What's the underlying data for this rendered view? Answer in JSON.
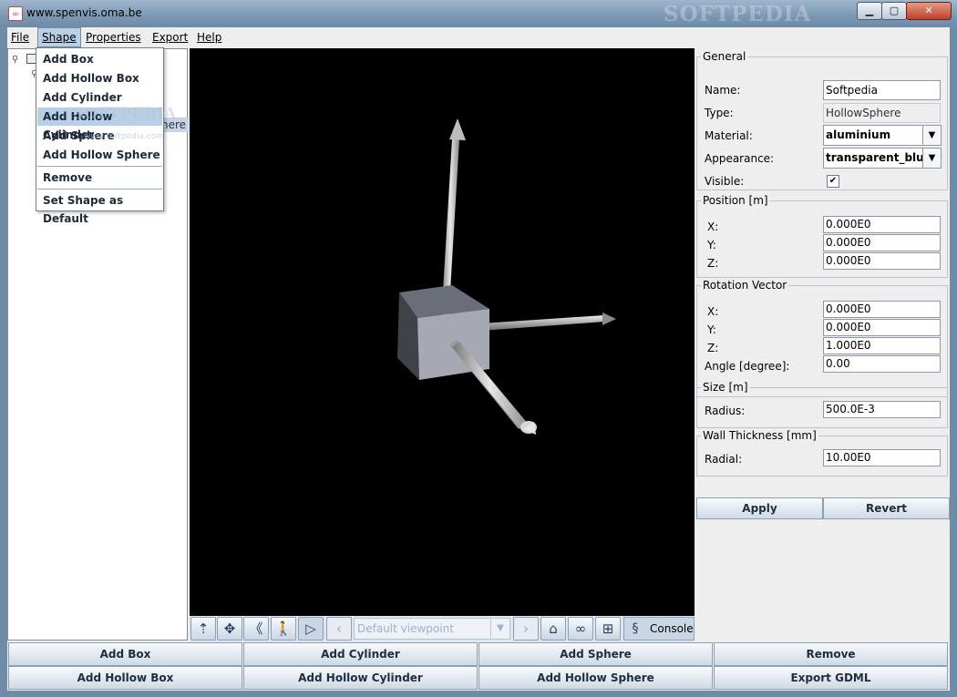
{
  "window": {
    "title": "www.spenvis.oma.be",
    "watermark": "SOFTPEDIA",
    "minimize": "▁",
    "maximize": "▢",
    "close": "✕"
  },
  "menubar": {
    "items": [
      "File",
      "Shape",
      "Properties",
      "Export",
      "Help"
    ],
    "open_menu": "Shape"
  },
  "shape_menu": {
    "items": [
      "Add Box",
      "Add Hollow Box",
      "Add Cylinder",
      "Add Hollow Cylinder",
      "Add Sphere",
      "Add Hollow Sphere"
    ],
    "highlighted": "Add Hollow Cylinder",
    "remove": "Remove",
    "set_default": "Set Shape as Default",
    "overlay_watermark": "SOFTPEDIA",
    "overlay_url": "www.softpedia.com"
  },
  "tree": {
    "selected_suffix": "here"
  },
  "navbar": {
    "viewpoint_placeholder": "Default viewpoint",
    "console_label": "Console",
    "icons": [
      "rotate-icon",
      "pan-icon",
      "zoom-icon",
      "walk-icon",
      "fly-icon",
      "prev-viewpoint-icon",
      "next-viewpoint-icon",
      "home-icon",
      "binoculars-icon",
      "fit-view-icon",
      "console-icon"
    ]
  },
  "properties": {
    "general": {
      "title": "General",
      "name_label": "Name:",
      "name_value": "Softpedia",
      "type_label": "Type:",
      "type_value": "HollowSphere",
      "material_label": "Material:",
      "material_value": "aluminium",
      "appearance_label": "Appearance:",
      "appearance_value": "transparent_blue",
      "visible_label": "Visible:",
      "visible_checked": "✔"
    },
    "position": {
      "title": "Position [m]",
      "x_label": "X:",
      "x_value": "0.000E0",
      "y_label": "Y:",
      "y_value": "0.000E0",
      "z_label": "Z:",
      "z_value": "0.000E0"
    },
    "rotation": {
      "title": "Rotation Vector",
      "x_label": "X:",
      "x_value": "0.000E0",
      "y_label": "Y:",
      "y_value": "0.000E0",
      "z_label": "Z:",
      "z_value": "1.000E0",
      "angle_label": "Angle [degree]:",
      "angle_value": "0.00"
    },
    "size": {
      "title": "Size [m]",
      "radius_label": "Radius:",
      "radius_value": "500.0E-3"
    },
    "wall": {
      "title": "Wall Thickness [mm]",
      "radial_label": "Radial:",
      "radial_value": "10.00E0"
    },
    "apply": "Apply",
    "revert": "Revert"
  },
  "bottom_buttons": {
    "add_box": "Add Box",
    "add_cylinder": "Add Cylinder",
    "add_sphere": "Add Sphere",
    "remove": "Remove",
    "add_hollow_box": "Add Hollow Box",
    "add_hollow_cylinder": "Add Hollow Cylinder",
    "add_hollow_sphere": "Add Hollow Sphere",
    "export_gdml": "Export GDML"
  }
}
